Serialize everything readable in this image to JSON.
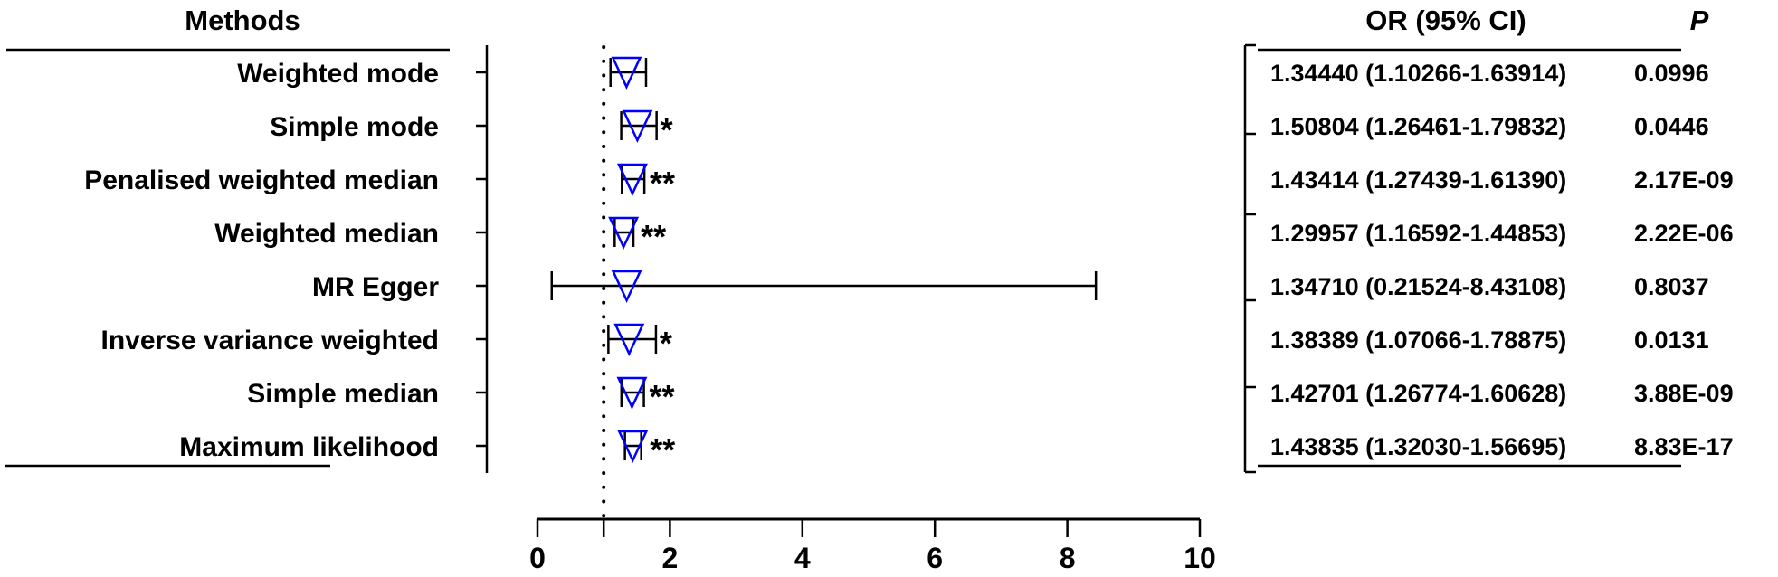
{
  "chart_data": {
    "type": "forest",
    "title": "",
    "xlabel": "",
    "ylabel": "",
    "xlim": [
      0,
      10
    ],
    "xticks": [
      0,
      2,
      4,
      6,
      8,
      10
    ],
    "reference_line": 1,
    "headers": {
      "methods": "Methods",
      "or_ci": "OR (95% CI)",
      "p": "P"
    },
    "marker_color": "#0000ff",
    "rows": [
      {
        "method": "Weighted mode",
        "or": 1.3444,
        "lower": 1.10266,
        "upper": 1.63914,
        "or_ci_text": "1.34440 (1.10266-1.63914)",
        "p": "0.0996",
        "sig": ""
      },
      {
        "method": "Simple mode",
        "or": 1.50804,
        "lower": 1.26461,
        "upper": 1.79832,
        "or_ci_text": "1.50804 (1.26461-1.79832)",
        "p": "0.0446",
        "sig": "*"
      },
      {
        "method": "Penalised weighted median",
        "or": 1.43414,
        "lower": 1.27439,
        "upper": 1.6139,
        "or_ci_text": "1.43414 (1.27439-1.61390)",
        "p": "2.17E-09",
        "sig": "**"
      },
      {
        "method": "Weighted median",
        "or": 1.29957,
        "lower": 1.16592,
        "upper": 1.44853,
        "or_ci_text": "1.29957 (1.16592-1.44853)",
        "p": "2.22E-06",
        "sig": "**"
      },
      {
        "method": "MR Egger",
        "or": 1.3471,
        "lower": 0.21524,
        "upper": 8.43108,
        "or_ci_text": "1.34710 (0.21524-8.43108)",
        "p": "0.8037",
        "sig": ""
      },
      {
        "method": "Inverse variance weighted",
        "or": 1.38389,
        "lower": 1.07066,
        "upper": 1.78875,
        "or_ci_text": "1.38389 (1.07066-1.78875)",
        "p": "0.0131",
        "sig": "*"
      },
      {
        "method": "Simple median",
        "or": 1.42701,
        "lower": 1.26774,
        "upper": 1.60628,
        "or_ci_text": "1.42701 (1.26774-1.60628)",
        "p": "3.88E-09",
        "sig": "**"
      },
      {
        "method": "Maximum likelihood",
        "or": 1.43835,
        "lower": 1.3203,
        "upper": 1.56695,
        "or_ci_text": "1.43835 (1.32030-1.56695)",
        "p": "8.83E-17",
        "sig": "**"
      }
    ]
  }
}
